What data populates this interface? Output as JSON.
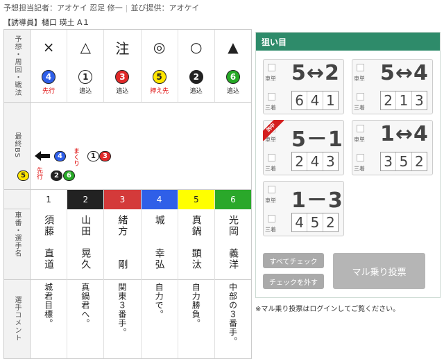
{
  "header": {
    "writer_label": "予想担当記者：アオケイ 忍足 修一",
    "provider_label": "並び提供：アオケイ",
    "sub": "【誘導員】樋口 瑛土 A１"
  },
  "labels": {
    "prediction": "予想・周回・戦法",
    "bs": "最終BS",
    "car_number": "車番・選手名",
    "comment": "選手コメント"
  },
  "marks": [
    "×",
    "△",
    "注",
    "◎",
    "○",
    "▲"
  ],
  "tactics": [
    {
      "num": "4",
      "tactic": "先行",
      "bg": "#2f5fe8",
      "fg": "#ffffff",
      "red": true
    },
    {
      "num": "1",
      "tactic": "追込",
      "bg": "#ffffff",
      "fg": "#222222",
      "red": false
    },
    {
      "num": "3",
      "tactic": "追込",
      "bg": "#e02929",
      "fg": "#ffffff",
      "red": false
    },
    {
      "num": "5",
      "tactic": "押え先",
      "bg": "#ffe600",
      "fg": "#222222",
      "red": true
    },
    {
      "num": "2",
      "tactic": "追込",
      "bg": "#222222",
      "fg": "#ffffff",
      "red": false
    },
    {
      "num": "6",
      "tactic": "追込",
      "bg": "#26a926",
      "fg": "#ffffff",
      "red": false
    }
  ],
  "bs": {
    "makuri": "まくり",
    "senko": "先行",
    "top_row": [
      "4",
      "1",
      "3"
    ],
    "bottom_row": [
      "5",
      "2",
      "6"
    ]
  },
  "riders": [
    {
      "num": "1",
      "name": "須藤　直道",
      "comment": "城君目標。",
      "bg": "#ffffff",
      "fg": "#222222"
    },
    {
      "num": "2",
      "name": "山田　晃久",
      "comment": "真鍋君へ。",
      "bg": "#222222",
      "fg": "#ffffff"
    },
    {
      "num": "3",
      "name": "緒方　　剛",
      "comment": "関東３番手。",
      "bg": "#d43a3a",
      "fg": "#ffffff"
    },
    {
      "num": "4",
      "name": "城　　幸弘",
      "comment": "自力で。",
      "bg": "#2f5fe8",
      "fg": "#ffffff"
    },
    {
      "num": "5",
      "name": "真鍋　顕汰",
      "comment": "自力勝負。",
      "bg": "#ffff00",
      "fg": "#222222"
    },
    {
      "num": "6",
      "name": "光岡　義洋",
      "comment": "中部の３番手。",
      "bg": "#2aa82a",
      "fg": "#ffffff"
    }
  ],
  "panel": {
    "title": "狙い目",
    "tansha_label": "車単",
    "sanchaku_label": "三着",
    "hit_label": "的中",
    "picks": [
      {
        "combo": "5↔2",
        "digits": [
          "6",
          "4",
          "1"
        ],
        "hit": false
      },
      {
        "combo": "5↔4",
        "digits": [
          "2",
          "1",
          "3"
        ],
        "hit": false
      },
      {
        "combo": "5－1",
        "digits": [
          "2",
          "4",
          "3"
        ],
        "hit": true
      },
      {
        "combo": "1↔4",
        "digits": [
          "3",
          "5",
          "2"
        ],
        "hit": false
      },
      {
        "combo": "1－3",
        "digits": [
          "4",
          "5",
          "2"
        ],
        "hit": false
      }
    ],
    "check_all": "すべてチェック",
    "uncheck": "チェックを外す",
    "submit": "マル乗り投票"
  },
  "note": "※マル乗り投票はログインしてご覧ください。"
}
